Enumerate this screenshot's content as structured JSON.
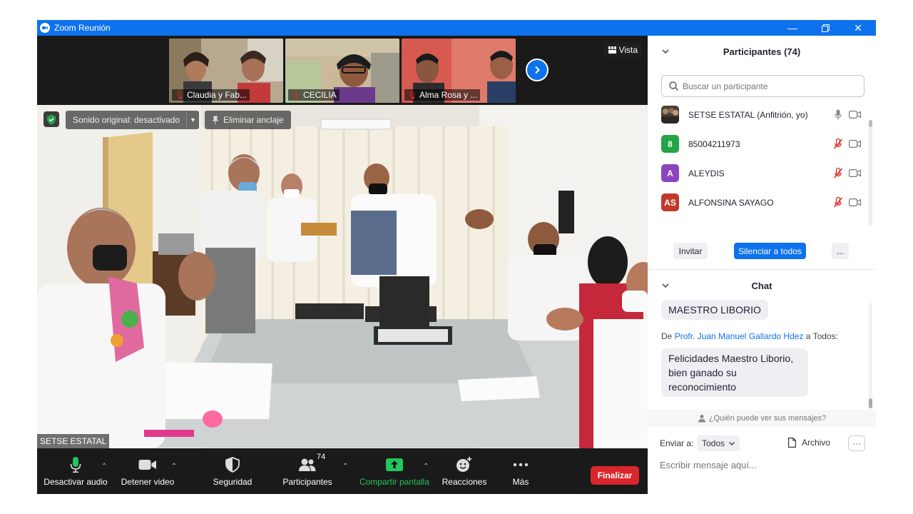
{
  "window": {
    "title": "Zoom Reunión"
  },
  "thumbnails": [
    {
      "name": "Claudia y Fab..."
    },
    {
      "name": "CECILIA"
    },
    {
      "name": "Alma Rosa y ..."
    }
  ],
  "video": {
    "view_label": "Vista",
    "original_sound": "Sonido original: desactivado",
    "unpin": "Eliminar anclaje",
    "speaker": "SETSE ESTATAL"
  },
  "toolbar": {
    "mute": "Desactivar audio",
    "video": "Detener video",
    "security": "Seguridad",
    "participants": "Participantes",
    "participants_count": "74",
    "share": "Compartir pantalla",
    "reactions": "Reacciones",
    "more": "Más",
    "end": "Finalizar"
  },
  "participants_panel": {
    "title": "Participantes (74)",
    "search_placeholder": "Buscar un participante",
    "items": [
      {
        "avatar": "",
        "name": "SETSE ESTATAL (Anfitrión, yo)",
        "avatar_color": "#555555",
        "mic": "on"
      },
      {
        "avatar": "8",
        "name": "85004211973",
        "avatar_color": "#22a447",
        "mic": "off"
      },
      {
        "avatar": "A",
        "name": "ALEYDIS",
        "avatar_color": "#8c44bd",
        "mic": "off"
      },
      {
        "avatar": "AS",
        "name": "ALFONSINA SAYAGO",
        "avatar_color": "#c0392b",
        "mic": "off"
      }
    ],
    "invite": "Invitar",
    "mute_all": "Silenciar a todos",
    "more": "..."
  },
  "chat": {
    "title": "Chat",
    "message1": "MAESTRO LIBORIO",
    "from_prefix": "De",
    "from_name": "Profr. Juan Manuel Gallardo Hdez",
    "to_text": "a Todos:",
    "message2": "Felicidades Maestro Liborio, bien ganado su reconocimiento",
    "who_sees": "¿Quién puede ver sus mensajes?",
    "send_to_label": "Enviar a:",
    "send_to_value": "Todos",
    "file": "Archivo",
    "more": "···",
    "input_placeholder": "Escribir mensaje aquí..."
  },
  "colors": {
    "accent": "#0e72ed",
    "end_red": "#d9262b",
    "share_green": "#22c55e"
  }
}
